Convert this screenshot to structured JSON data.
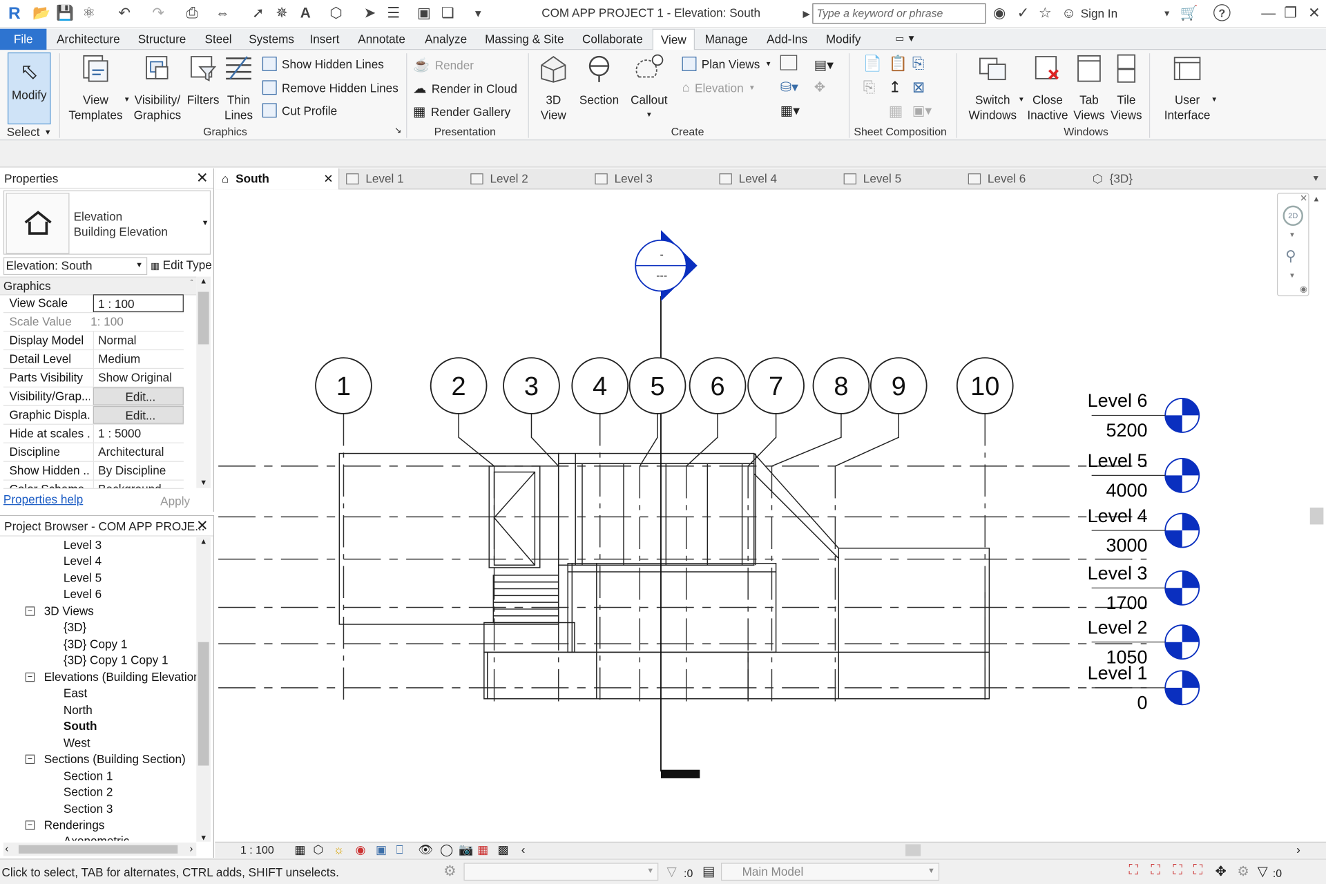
{
  "app": {
    "title": "COM APP PROJECT 1 - Elevation: South",
    "search_placeholder": "Type a keyword or phrase",
    "sign_in": "Sign In"
  },
  "ribbon_tabs": [
    "File",
    "Architecture",
    "Structure",
    "Steel",
    "Systems",
    "Insert",
    "Annotate",
    "Analyze",
    "Massing & Site",
    "Collaborate",
    "View",
    "Manage",
    "Add-Ins",
    "Modify"
  ],
  "ribbon": {
    "modify": "Modify",
    "select": "Select",
    "graphics": {
      "title": "Graphics",
      "view_templates": [
        "View",
        "Templates"
      ],
      "visibility_graphics": [
        "Visibility/",
        "Graphics"
      ],
      "filters": "Filters",
      "thin_lines": [
        "Thin",
        "Lines"
      ],
      "show_hidden_lines": "Show  Hidden Lines",
      "remove_hidden_lines": "Remove  Hidden Lines",
      "cut_profile": "Cut  Profile"
    },
    "presentation": {
      "title": "Presentation",
      "render": "Render",
      "render_in_cloud": "Render  in Cloud",
      "render_gallery": "Render  Gallery"
    },
    "create": {
      "title": "Create",
      "view_3d": [
        "3D",
        "View"
      ],
      "section": "Section",
      "callout": "Callout",
      "plan_views": "Plan  Views",
      "elevation": "Elevation"
    },
    "sheet_composition": {
      "title": "Sheet Composition"
    },
    "windows": {
      "title": "Windows",
      "switch_windows": [
        "Switch",
        "Windows"
      ],
      "close_inactive": [
        "Close",
        "Inactive"
      ],
      "tab_views": [
        "Tab",
        "Views"
      ],
      "tile_views": [
        "Tile",
        "Views"
      ],
      "user_interface": [
        "User",
        "Interface"
      ]
    }
  },
  "properties": {
    "title": "Properties",
    "type_line1": "Elevation",
    "type_line2": "Building Elevation",
    "selector": "Elevation: South",
    "edit_type": "Edit Type",
    "section": "Graphics",
    "rows": [
      {
        "k": "View Scale",
        "v": "1 : 100"
      },
      {
        "k": "Scale Value",
        "v": "1:  100"
      },
      {
        "k": "Display Model",
        "v": "Normal"
      },
      {
        "k": "Detail Level",
        "v": "Medium"
      },
      {
        "k": "Parts Visibility",
        "v": "Show Original"
      },
      {
        "k": "Visibility/Grap...",
        "v": "Edit..."
      },
      {
        "k": "Graphic Displa...",
        "v": "Edit..."
      },
      {
        "k": "Hide at scales ...",
        "v": "1 : 5000"
      },
      {
        "k": "Discipline",
        "v": "Architectural"
      },
      {
        "k": "Show Hidden ...",
        "v": "By Discipline"
      },
      {
        "k": "Color Scheme ...",
        "v": "Background"
      }
    ],
    "help": "Properties help",
    "apply": "Apply"
  },
  "browser": {
    "title": "Project Browser - COM APP PROJE...",
    "items": [
      {
        "t": "Level 3",
        "lvl": 2
      },
      {
        "t": "Level 4",
        "lvl": 2
      },
      {
        "t": "Level 5",
        "lvl": 2
      },
      {
        "t": "Level 6",
        "lvl": 2
      },
      {
        "t": "3D Views",
        "lvl": 1
      },
      {
        "t": "{3D}",
        "lvl": 2
      },
      {
        "t": "{3D} Copy 1",
        "lvl": 2
      },
      {
        "t": "{3D} Copy 1 Copy 1",
        "lvl": 2
      },
      {
        "t": "Elevations (Building Elevation",
        "lvl": 1
      },
      {
        "t": "East",
        "lvl": 2
      },
      {
        "t": "North",
        "lvl": 2
      },
      {
        "t": "South",
        "lvl": 2
      },
      {
        "t": "West",
        "lvl": 2
      },
      {
        "t": "Sections (Building Section)",
        "lvl": 1
      },
      {
        "t": "Section 1",
        "lvl": 2
      },
      {
        "t": "Section 2",
        "lvl": 2
      },
      {
        "t": "Section 3",
        "lvl": 2
      },
      {
        "t": "Renderings",
        "lvl": 1
      },
      {
        "t": "Axonometric",
        "lvl": 2
      }
    ]
  },
  "view_tabs": [
    "South",
    "Level 1",
    "Level 2",
    "Level 3",
    "Level 4",
    "Level 5",
    "Level 6",
    "{3D}"
  ],
  "drawing": {
    "grids": [
      "1",
      "2",
      "3",
      "4",
      "5",
      "6",
      "7",
      "8",
      "9",
      "10"
    ],
    "marker_top": "-",
    "marker_bottom": "---",
    "levels": [
      {
        "name": "Level 6",
        "elev": "5200"
      },
      {
        "name": "Level 5",
        "elev": "4000"
      },
      {
        "name": "Level 4",
        "elev": "3000"
      },
      {
        "name": "Level 3",
        "elev": "1700"
      },
      {
        "name": "Level 2",
        "elev": "1050"
      },
      {
        "name": "Level 1",
        "elev": "0"
      }
    ],
    "accent": "#0a2fbf"
  },
  "view_control": {
    "scale": "1 : 100"
  },
  "status": {
    "message": "Click to select, TAB for alternates, CTRL adds, SHIFT unselects.",
    "zero1": ":0",
    "model": "Main Model",
    "zero2": ":0"
  }
}
